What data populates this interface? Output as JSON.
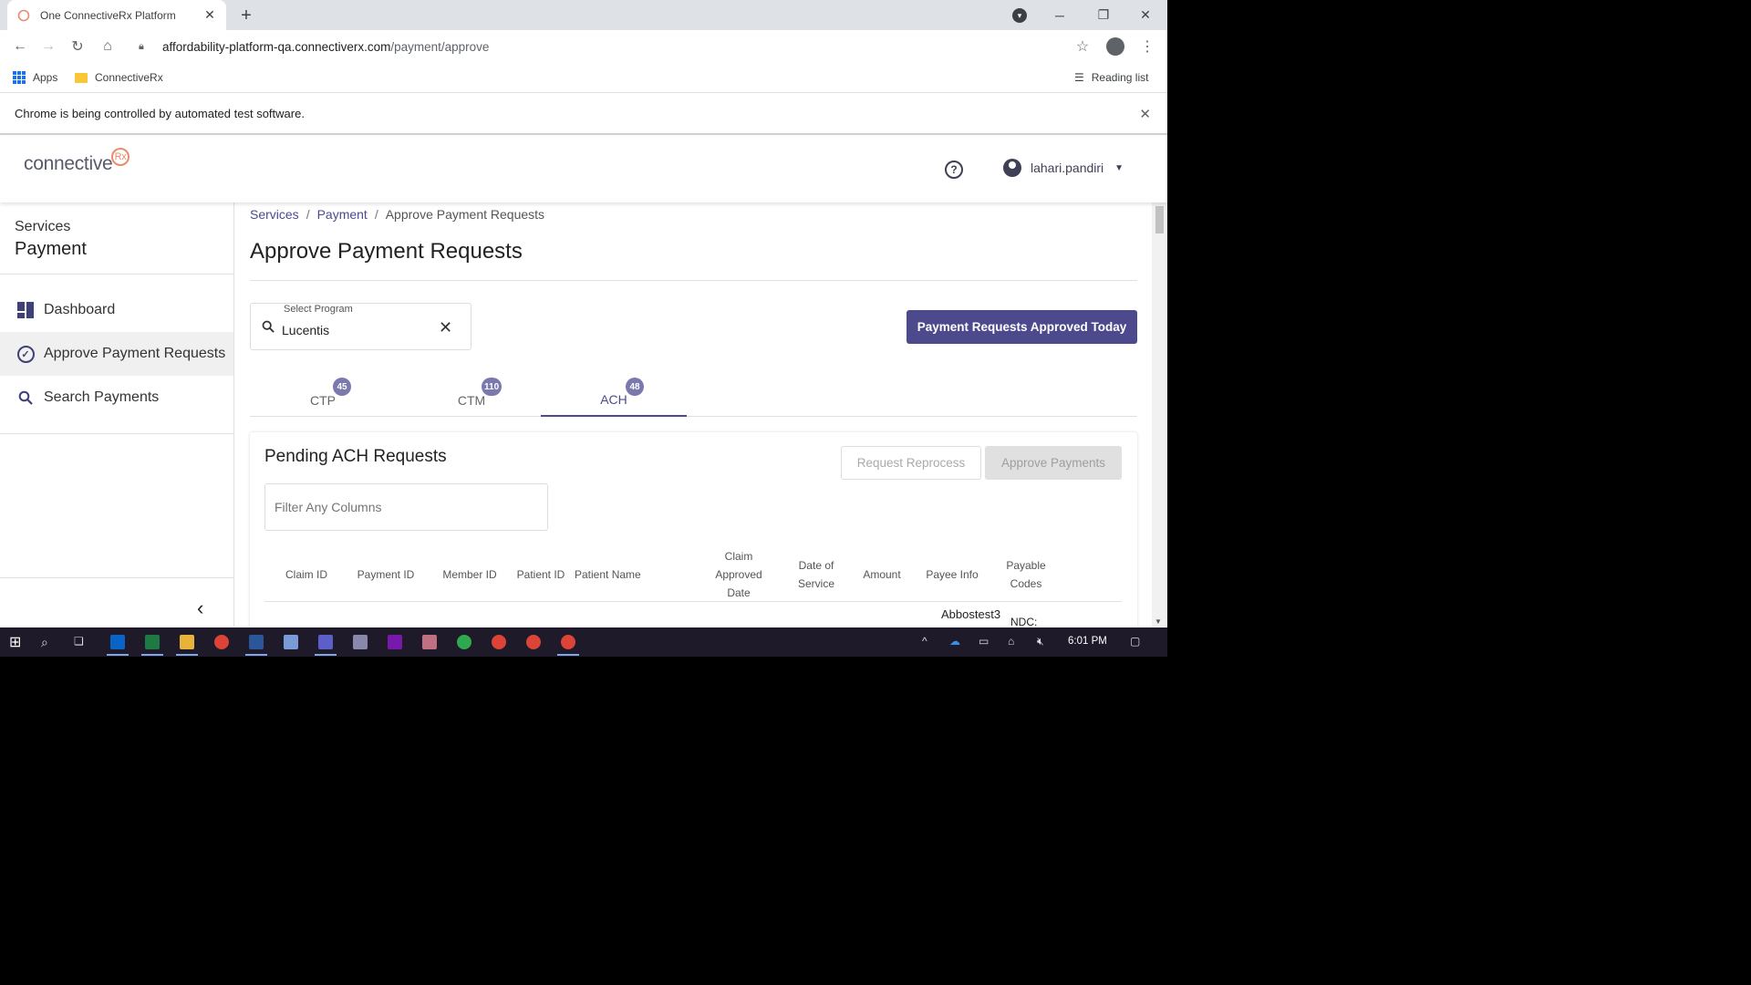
{
  "browser": {
    "tab_title": "One ConnectiveRx Platform",
    "url_host": "affordability-platform-qa.connectiverx.com",
    "url_path": "/payment/approve",
    "bookmarks": [
      "Apps",
      "ConnectiveRx"
    ],
    "reading_list": "Reading list",
    "infobar": "Chrome is being controlled by automated test software."
  },
  "header": {
    "logo_text": "connective",
    "logo_mark": "Rx",
    "username": "lahari.pandiri"
  },
  "sidebar": {
    "category": "Services",
    "title": "Payment",
    "items": [
      {
        "label": "Dashboard"
      },
      {
        "label": "Approve Payment Requests"
      },
      {
        "label": "Search Payments"
      }
    ]
  },
  "main": {
    "breadcrumb": [
      "Services",
      "Payment",
      "Approve Payment Requests"
    ],
    "title": "Approve Payment Requests",
    "select_program": {
      "label": "Select Program",
      "value": "Lucentis"
    },
    "approved_today_button": "Payment Requests Approved Today",
    "tabs": [
      {
        "label": "CTP",
        "count": "45"
      },
      {
        "label": "CTM",
        "count": "110"
      },
      {
        "label": "ACH",
        "count": "48"
      }
    ],
    "card": {
      "title": "Pending ACH Requests",
      "reprocess_button": "Request Reprocess",
      "approve_button": "Approve Payments",
      "filter_placeholder": "Filter Any Columns",
      "columns": [
        "Claim ID",
        "Payment ID",
        "Member ID",
        "Patient ID",
        "Patient Name",
        "Claim Approved Date",
        "Date of Service",
        "Amount",
        "Payee Info",
        "Payable Codes"
      ],
      "first_row": {
        "payee_info": "Abbostest3",
        "payable_codes": "NDC:"
      }
    }
  },
  "taskbar": {
    "clock": "6:01 PM"
  },
  "colors": {
    "brand": "#4c4a8c",
    "badge": "#7a78ad",
    "taskbar": "#1f1a2a"
  }
}
